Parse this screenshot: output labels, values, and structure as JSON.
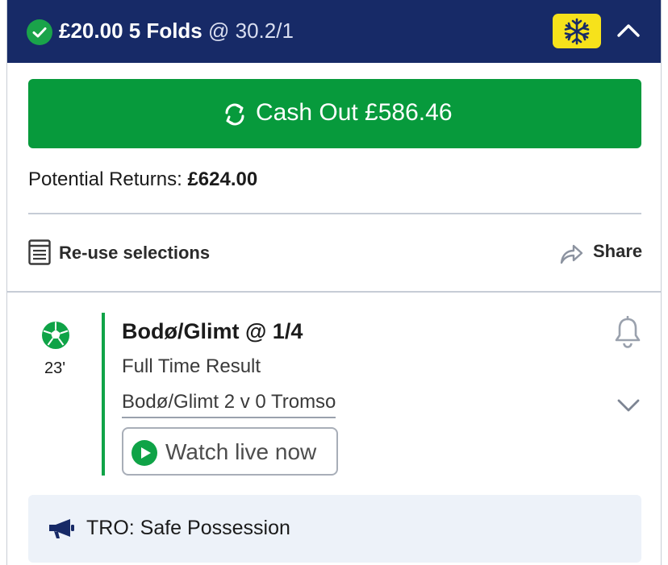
{
  "header": {
    "stake": "£20.00 5 Folds",
    "odds": "@ 30.2/1",
    "colors": {
      "background": "#172a67",
      "freeze": "#f6e21b",
      "check": "#1aa34a"
    }
  },
  "cashout": {
    "label": "Cash Out £586.46",
    "color": "#079a3c"
  },
  "returns": {
    "label": "Potential Returns: ",
    "value": "£624.00"
  },
  "actions": {
    "reuse_label": "Re-use selections",
    "share_label": "Share"
  },
  "selection": {
    "minute": "23'",
    "title": "Bodø/Glimt @ 1/4",
    "market": "Full Time Result",
    "event": "Bodø/Glimt 2 v 0 Tromso",
    "watch_label": "Watch live now",
    "accent": "#0fa347"
  },
  "commentary": {
    "text": "TRO: Safe Possession"
  },
  "icons": [
    "check-icon",
    "snowflake-icon",
    "chevron-up-icon",
    "cash-out-icon",
    "list-icon",
    "share-icon",
    "football-icon",
    "bell-icon",
    "chevron-down-icon",
    "play-icon",
    "megaphone-icon"
  ]
}
